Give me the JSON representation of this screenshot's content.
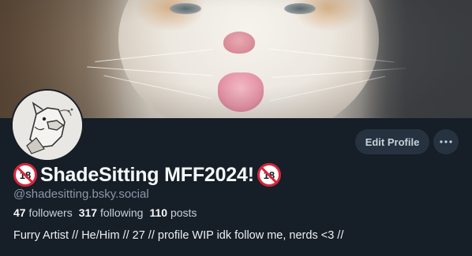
{
  "profile": {
    "display_name": "ShadeSitting MFF2024!",
    "badge_left": "18",
    "badge_right": "18",
    "handle": "@shadesitting.bsky.social",
    "followers_count": "47",
    "followers_label": "followers",
    "following_count": "317",
    "following_label": "following",
    "posts_count": "110",
    "posts_label": "posts",
    "bio": "Furry Artist // He/Him // 27 // profile WIP idk follow me, nerds <3 //"
  },
  "actions": {
    "edit_label": "Edit Profile",
    "more_label": "···"
  },
  "colors": {
    "background": "#161e27",
    "button_bg": "#26323f",
    "muted_text": "#8b98a5",
    "badge_red": "#d7263d"
  },
  "icons": {
    "banner": "cat-banner-image",
    "avatar": "sketch-avatar-image",
    "badge": "no-under-18-icon",
    "more": "ellipsis-icon"
  }
}
